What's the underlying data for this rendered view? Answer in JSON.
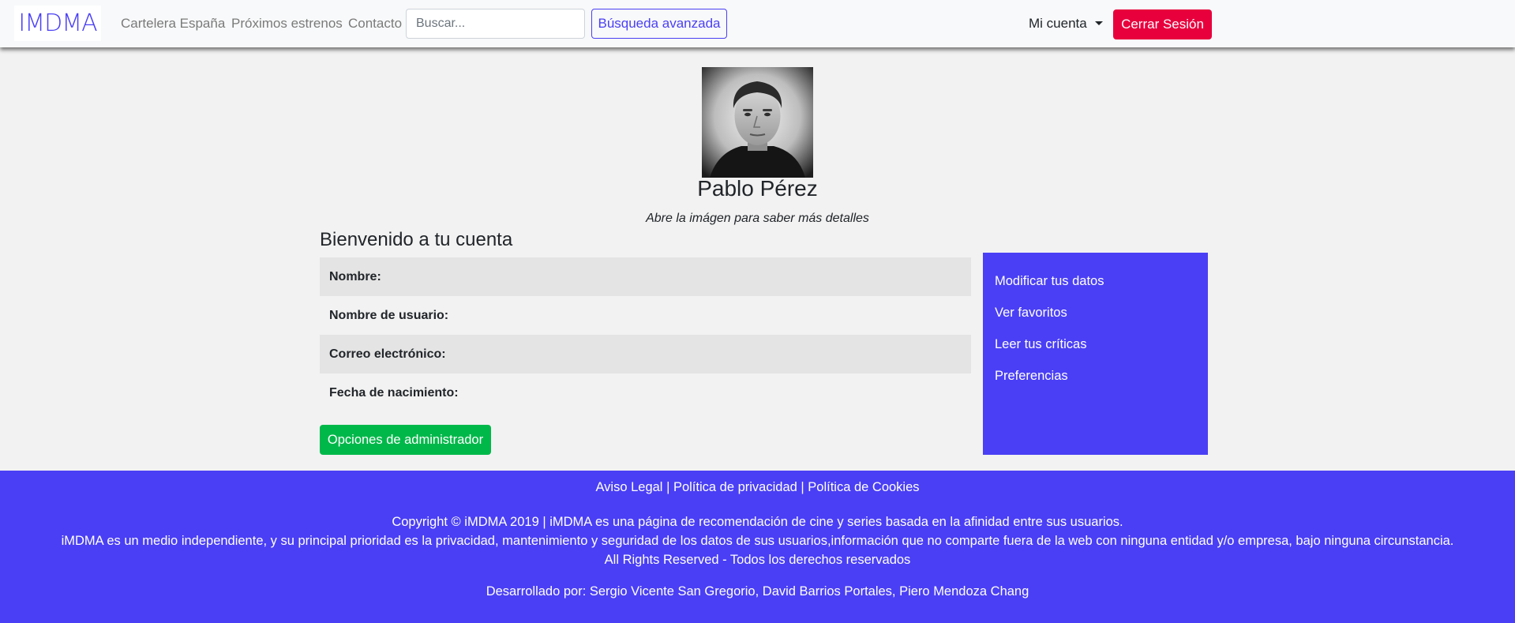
{
  "navbar": {
    "brand": "IMDMA",
    "links": [
      "Cartelera España",
      "Próximos estrenos",
      "Contacto"
    ],
    "search_placeholder": "Buscar...",
    "advanced_search": "Búsqueda avanzada",
    "account": "Mi cuenta",
    "logout": "Cerrar Sesión"
  },
  "profile": {
    "name": "Pablo Pérez",
    "hint": "Abre la imágen para saber más detalles"
  },
  "account": {
    "welcome": "Bienvenido a tu cuenta",
    "fields": [
      "Nombre:",
      "Nombre de usuario:",
      "Correo electrónico:",
      "Fecha de nacimiento:"
    ],
    "admin_button": "Opciones de administrador"
  },
  "side_menu": {
    "items": [
      "Modificar tus datos",
      "Ver favoritos",
      "Leer tus críticas",
      "Preferencias"
    ]
  },
  "footer": {
    "legal_links": [
      "Aviso Legal",
      "Política de privacidad",
      "Política de Cookies"
    ],
    "separator": "|",
    "copyright": "Copyright © iMDMA 2019 | iMDMA es una página de recomendación de cine y series basada en la afinidad entre sus usuarios.",
    "independence": "iMDMA es un medio independiente, y su principal prioridad es la privacidad, mantenimiento y seguridad de los datos de sus usuarios,información que no comparte fuera de la web con ninguna entidad y/o empresa, bajo ninguna circunstancia.",
    "rights": "All Rights Reserved - Todos los derechos reservados",
    "developers": "Desarrollado por: Sergio Vicente San Gregorio, David Barrios Portales, Piero Mendoza Chang"
  },
  "colors": {
    "brand": "#4a3ff5",
    "danger": "#e8003d",
    "success": "#00b84a"
  }
}
